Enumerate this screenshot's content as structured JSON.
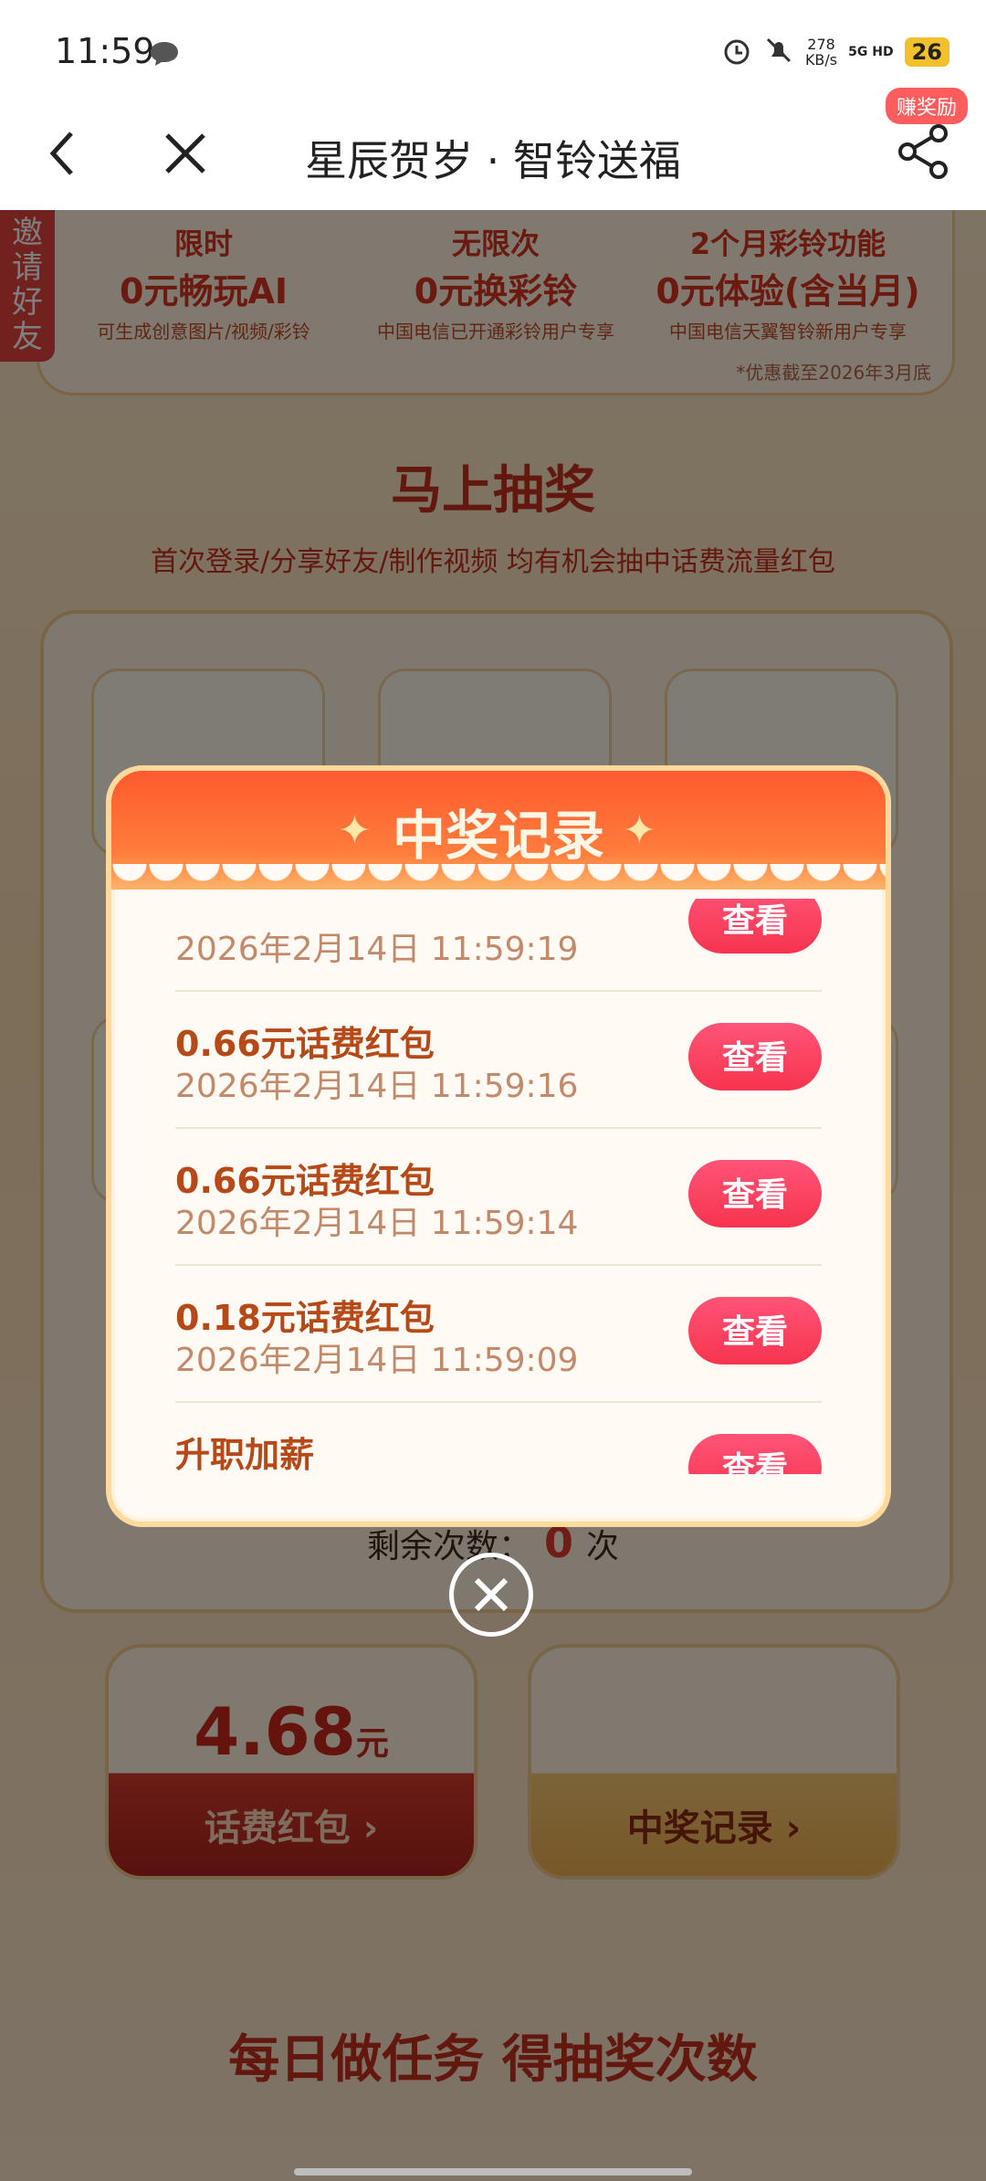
{
  "status": {
    "time": "11:59",
    "net_speed": "278",
    "net_unit": "KB/s",
    "network": "5G HD",
    "battery": "26"
  },
  "nav": {
    "title": "星辰贺岁 · 智铃送福",
    "reward_badge": "赚奖励"
  },
  "sidebar_tab": "邀请好友",
  "promos": [
    {
      "line1": "限时",
      "line2": "0元畅玩AI",
      "line3": "可生成创意图片/视频/彩铃"
    },
    {
      "line1": "无限次",
      "line2": "0元换彩铃",
      "line3": "中国电信已开通彩铃用户专享"
    },
    {
      "line1": "2个月彩铃功能",
      "line2": "0元体验(含当月)",
      "line3": "中国电信天翼智铃新用户专享"
    }
  ],
  "promo_note": "*优惠截至2026年3月底",
  "lottery": {
    "title": "马上抽奖",
    "subtitle": "首次登录/分享好友/制作视频 均有机会抽中话费流量红包",
    "remaining_label": "剩余次数：",
    "remaining_count": "0",
    "remaining_unit": "次"
  },
  "wallet": {
    "amount": "4.68",
    "unit": "元",
    "red_button": "话费红包 ›",
    "records_button": "中奖记录 ›"
  },
  "task_title": "每日做任务 得抽奖次数",
  "modal": {
    "title": "中奖记录",
    "rows": [
      {
        "name": "",
        "date": "2026年2月14日 11:59:19",
        "button": "查看"
      },
      {
        "name": "0.66元话费红包",
        "date": "2026年2月14日 11:59:16",
        "button": "查看"
      },
      {
        "name": "0.66元话费红包",
        "date": "2026年2月14日 11:59:14",
        "button": "查看"
      },
      {
        "name": "0.18元话费红包",
        "date": "2026年2月14日 11:59:09",
        "button": "查看"
      },
      {
        "name": "升职加薪",
        "date": "",
        "button": "查看"
      }
    ]
  },
  "colors": {
    "accent": "#e23a2f",
    "button": "#f7344f",
    "modal_header": "#ff5a2e"
  }
}
